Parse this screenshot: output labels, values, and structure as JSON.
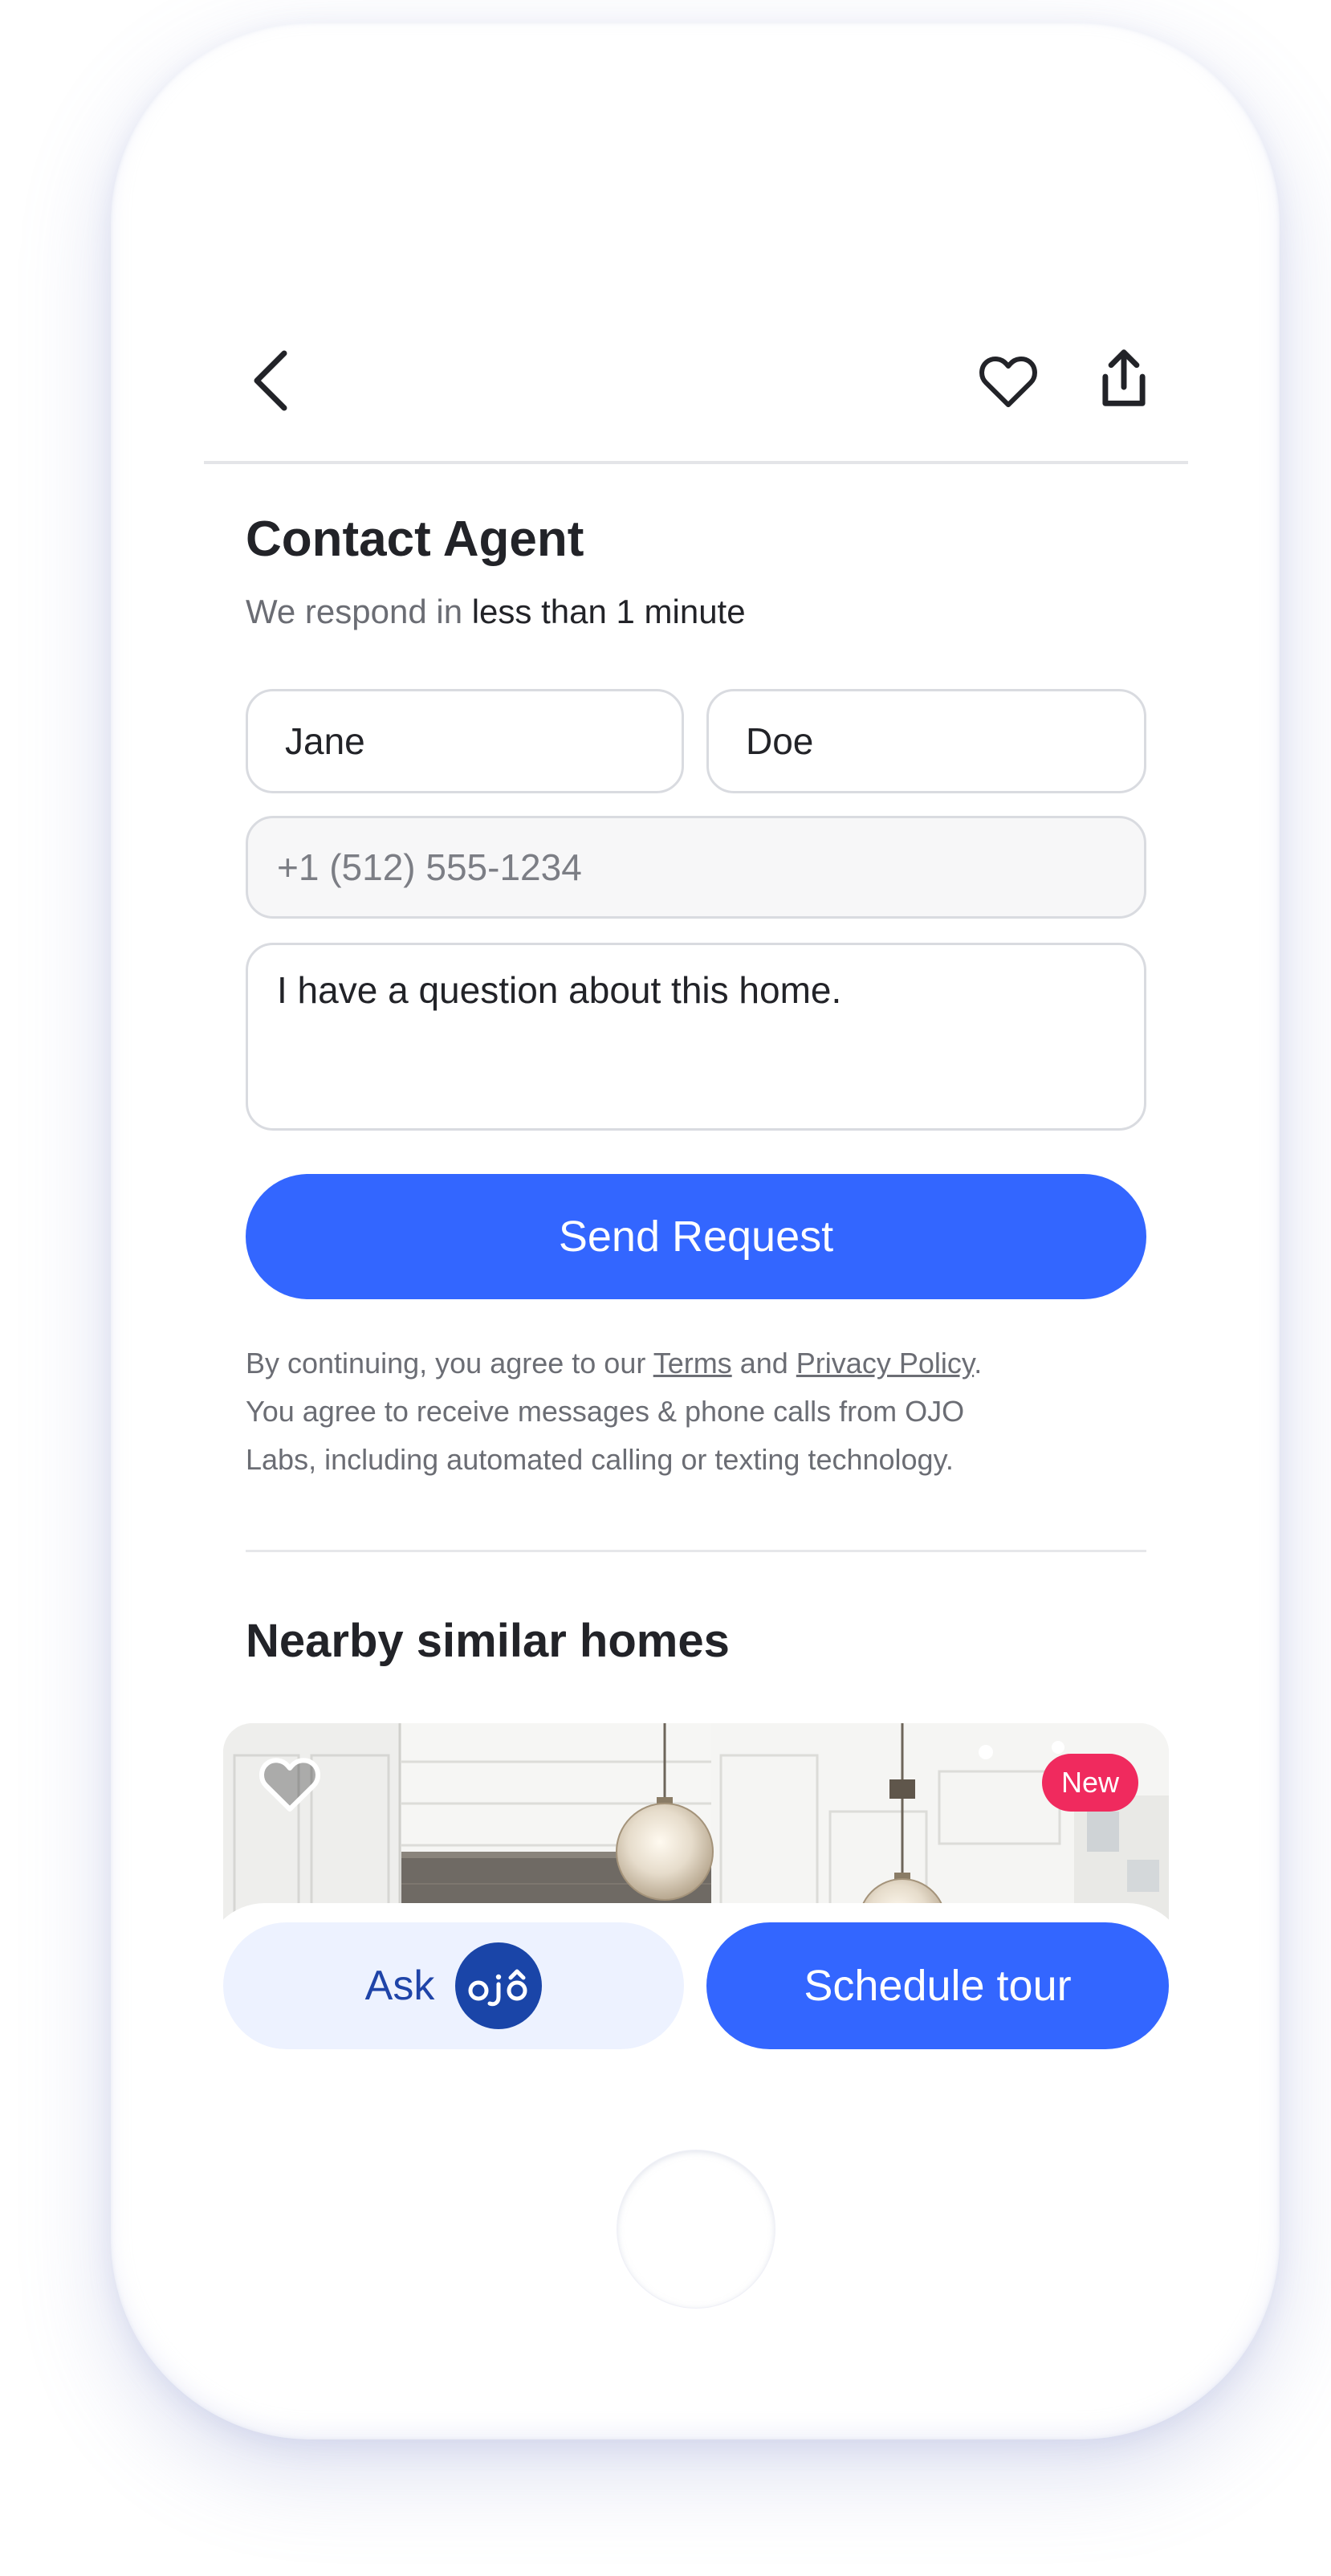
{
  "header": {
    "back_icon": "chevron-left-icon",
    "favorite_icon": "heart-outline-icon",
    "share_icon": "share-icon"
  },
  "contact": {
    "title": "Contact Agent",
    "subtitle_prefix": "We respond in",
    "subtitle_emphasis": "less than 1 minute",
    "first_name": "Jane",
    "last_name": "Doe",
    "phone_placeholder": "+1 (512) 555-1234",
    "message": "I have a question about this home.",
    "send_label": "Send Request"
  },
  "legal": {
    "prefix": "By continuing, you agree to our",
    "terms_link": "Terms",
    "and": "and",
    "privacy_link": "Privacy Policy",
    "period": ".",
    "line2": "You agree to receive messages & phone calls from OJO",
    "line3": "Labs, including automated calling or texting technology."
  },
  "nearby": {
    "title": "Nearby similar homes",
    "listing": {
      "badge": "New",
      "favorite_icon": "heart-icon"
    }
  },
  "actions": {
    "ask_label": "Ask",
    "ojo_logo_text": "ojo",
    "tour_label": "Schedule tour"
  },
  "colors": {
    "primary": "#3366ff",
    "ask_bg": "#edf2ff",
    "ask_text": "#1f44a8",
    "badge": "#f02a5e",
    "text": "#222328",
    "muted": "#6b6d74"
  }
}
